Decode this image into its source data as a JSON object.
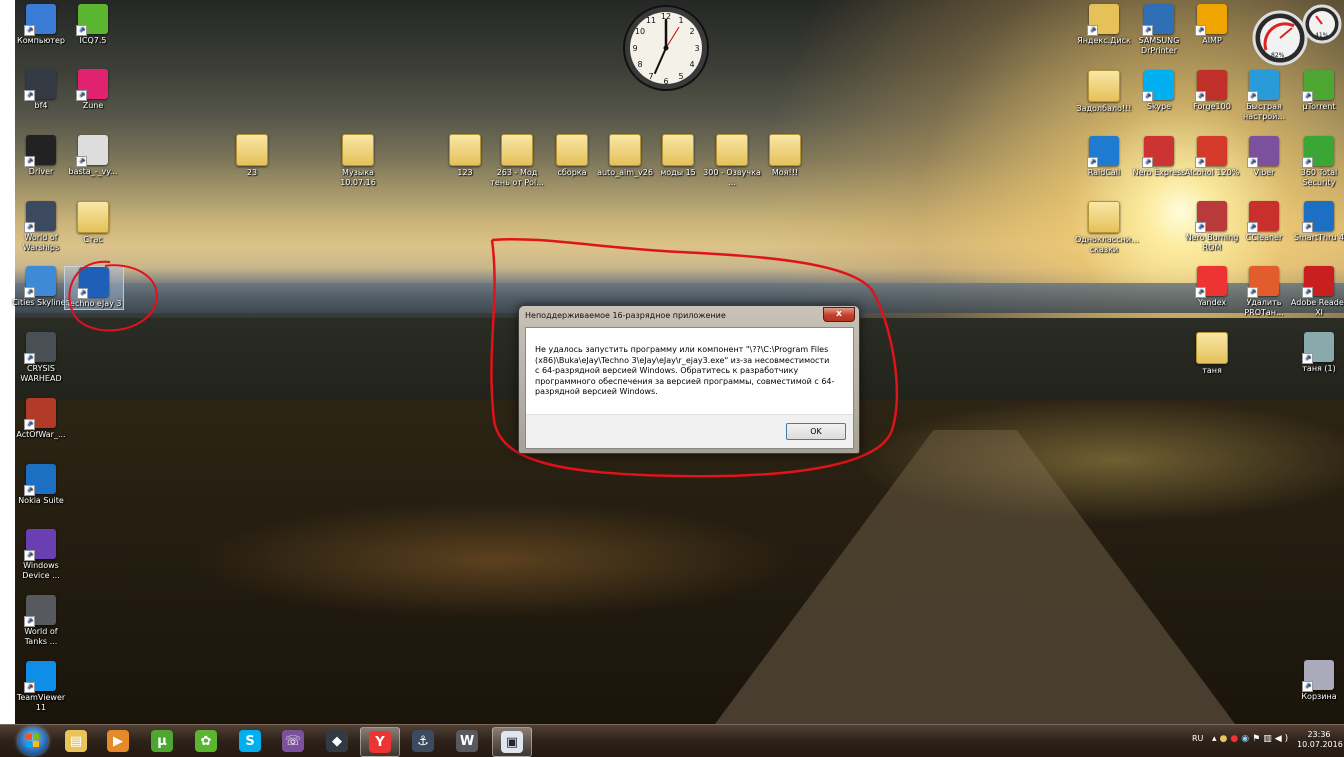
{
  "desktop": {
    "left_icons": [
      {
        "label": "Компьютер",
        "icon": "computer-icon",
        "color": "#3a7bd5"
      },
      {
        "label": "ICQ7.5",
        "icon": "icq-flower-icon",
        "color": "#5cb531"
      },
      {
        "label": "bf4",
        "icon": "bf4-icon",
        "color": "#333a44"
      },
      {
        "label": "Zune",
        "icon": "zune-icon",
        "color": "#e0236f"
      },
      {
        "label": "Driver",
        "icon": "driver-icon",
        "color": "#222"
      },
      {
        "label": "basta_-_vy...",
        "icon": "mp3-file-icon",
        "color": "#ddd"
      },
      {
        "label": "World of Warships",
        "icon": "world-of-warships-icon",
        "color": "#3b4a5e"
      },
      {
        "label": "Стас",
        "icon": "folder-icon",
        "color": "#e6c15a"
      },
      {
        "label": "Cities Skylines",
        "icon": "cities-skylines-icon",
        "color": "#3e8ad6"
      },
      {
        "label": "Techno eJay 3",
        "icon": "techno-ejay-icon",
        "color": "#1f5fb8"
      },
      {
        "label": "CRYSIS WARHEAD",
        "icon": "crysis-icon",
        "color": "#4a4e55"
      },
      {
        "label": "ActOfWar_...",
        "icon": "act-of-war-icon",
        "color": "#b23a28"
      },
      {
        "label": "Nokia Suite",
        "icon": "nokia-suite-icon",
        "color": "#1d6fc4"
      },
      {
        "label": "Windows Device ...",
        "icon": "windows-device-icon",
        "color": "#6a3fb3"
      },
      {
        "label": "World of Tanks ...",
        "icon": "world-of-tanks-icon",
        "color": "#565a5e"
      },
      {
        "label": "TeamViewer 11",
        "icon": "teamviewer-icon",
        "color": "#0e8ee9"
      }
    ],
    "folders": [
      {
        "label": "23"
      },
      {
        "label": "Музыка 10.07.16"
      },
      {
        "label": "123"
      },
      {
        "label": "263 - Мод тень от Pol..."
      },
      {
        "label": "сборка"
      },
      {
        "label": "auto_aim_v26"
      },
      {
        "label": "моды 15"
      },
      {
        "label": "300 - Озвучка ..."
      },
      {
        "label": "Моя!!!"
      }
    ],
    "right_icons": [
      {
        "label": "Яндекс.Диск",
        "icon": "yandex-disk-icon",
        "color": "#e6c15a"
      },
      {
        "label": "SAMSUNG DrPrinter",
        "icon": "samsung-drprinter-icon",
        "color": "#2f6fb5"
      },
      {
        "label": "AIMP",
        "icon": "aimp-icon",
        "color": "#f0a400"
      },
      {
        "label": "Задолбало!!!",
        "icon": "folder-icon",
        "color": "#e6c15a"
      },
      {
        "label": "Skype",
        "icon": "skype-icon",
        "color": "#00aff0"
      },
      {
        "label": "Forge100",
        "icon": "forge-icon",
        "color": "#c0302a"
      },
      {
        "label": "Быстрая настрой...",
        "icon": "quick-setup-icon",
        "color": "#2a9ad8"
      },
      {
        "label": "µTorrent",
        "icon": "utorrent-icon",
        "color": "#4da632"
      },
      {
        "label": "RaidCall",
        "icon": "raidcall-icon",
        "color": "#1f7bd0"
      },
      {
        "label": "Nero Express",
        "icon": "nero-express-icon",
        "color": "#c33"
      },
      {
        "label": "Alcohol 120%",
        "icon": "alcohol-icon",
        "color": "#d43a2a"
      },
      {
        "label": "Viber",
        "icon": "viber-icon",
        "color": "#7b519d"
      },
      {
        "label": "360 Total Security",
        "icon": "360-security-icon",
        "color": "#3aa636"
      },
      {
        "label": "Одноклассни... сказки",
        "icon": "folder-icon",
        "color": "#e6c15a"
      },
      {
        "label": "Nero Burning ROM",
        "icon": "nero-burning-icon",
        "color": "#b83a3a"
      },
      {
        "label": "CCleaner",
        "icon": "ccleaner-icon",
        "color": "#c9302c"
      },
      {
        "label": "SmartThru 4",
        "icon": "smartthru-icon",
        "color": "#1d6fc4"
      },
      {
        "label": "Yandex",
        "icon": "yandex-icon",
        "color": "#e33"
      },
      {
        "label": "Удалить PROТан...",
        "icon": "uninstall-icon",
        "color": "#e25d2c"
      },
      {
        "label": "Adobe Reader XI",
        "icon": "adobe-reader-icon",
        "color": "#c91f1f"
      },
      {
        "label": "таня",
        "icon": "folder-icon",
        "color": "#e6c15a"
      },
      {
        "label": "таня (1)",
        "icon": "dvd-icon",
        "color": "#8aa"
      },
      {
        "label": "Корзина",
        "icon": "recycle-bin-icon",
        "color": "#aab"
      }
    ],
    "gauge": {
      "cpu": "82%",
      "ram": "41%"
    }
  },
  "dialog": {
    "title": "Неподдерживаемое 16-разрядное приложение",
    "message": "Не удалось запустить программу или компонент \"\\??\\C:\\Program Files (x86)\\Buka\\eJay\\Techno 3\\eJay\\eJay\\r_ejay3.exe\" из-за несовместимости с 64-разрядной версией Windows. Обратитесь к разработчику программного обеспечения за версией программы, совместимой с 64-разрядной версией Windows.",
    "ok_label": "OK",
    "close_glyph": "x"
  },
  "taskbar": {
    "items": [
      {
        "icon": "explorer-icon",
        "color": "#e8c45a",
        "glyph": "▤"
      },
      {
        "icon": "media-player-icon",
        "color": "#e58a2a",
        "glyph": "▶"
      },
      {
        "icon": "utorrent-icon",
        "color": "#4da632",
        "glyph": "µ"
      },
      {
        "icon": "icq-flower-icon",
        "color": "#5cb531",
        "glyph": "✿"
      },
      {
        "icon": "skype-icon",
        "color": "#00aff0",
        "glyph": "S"
      },
      {
        "icon": "viber-icon",
        "color": "#7b519d",
        "glyph": "☏"
      },
      {
        "icon": "bf4-icon",
        "color": "#333a44",
        "glyph": "◆"
      },
      {
        "icon": "yandex-icon",
        "color": "#e33",
        "glyph": "Y"
      },
      {
        "icon": "world-of-warships-icon",
        "color": "#3b4a5e",
        "glyph": "⚓"
      },
      {
        "icon": "world-of-tanks-icon",
        "color": "#565a5e",
        "glyph": "W"
      },
      {
        "icon": "ejay-window-icon",
        "color": "#dfe6ef",
        "glyph": "▣"
      }
    ],
    "language": "RU",
    "time": "23:36",
    "date": "10.07.2016"
  }
}
